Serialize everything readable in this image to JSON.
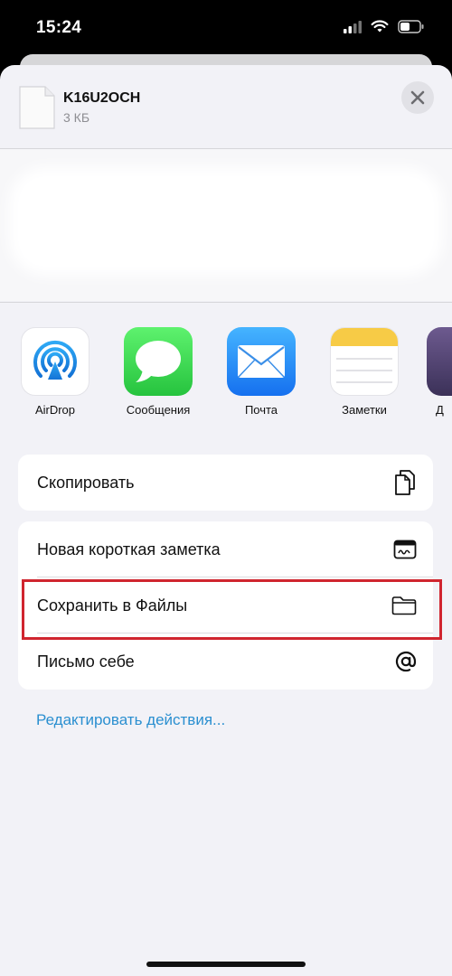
{
  "status": {
    "time": "15:24",
    "icons": [
      "signal-icon",
      "wifi-icon",
      "battery-icon"
    ]
  },
  "header": {
    "file_name": "K16U2OCH",
    "file_size": "3 КБ",
    "icons": [
      "file-icon",
      "close-icon"
    ]
  },
  "apps": [
    {
      "label": "AirDrop",
      "icon": "airdrop-icon"
    },
    {
      "label": "Сообщения",
      "icon": "messages-icon"
    },
    {
      "label": "Почта",
      "icon": "mail-icon"
    },
    {
      "label": "Заметки",
      "icon": "notes-icon"
    },
    {
      "label": "Д",
      "icon": "app-icon"
    }
  ],
  "actions": {
    "copy": {
      "label": "Скопировать",
      "icon": "copy-icon"
    },
    "new_note": {
      "label": "Новая короткая заметка",
      "icon": "quick-note-icon"
    },
    "save_files": {
      "label": "Сохранить в Файлы",
      "icon": "folder-icon"
    },
    "mail_self": {
      "label": "Письмо себе",
      "icon": "at-icon"
    }
  },
  "edit_actions": "Редактировать действия...",
  "colors": {
    "accent_link": "#2a8fd0",
    "highlight": "#d0252f",
    "messages_green": "#34c759",
    "mail_blue": "#1e88f5"
  }
}
